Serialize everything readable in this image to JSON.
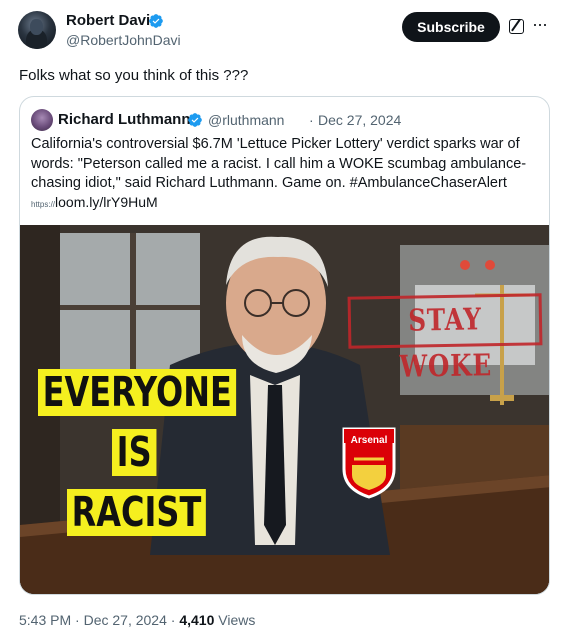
{
  "author": {
    "display_name": "Robert Davi",
    "handle": "@RobertJohnDavi",
    "verified_icon": "verified-badge-icon"
  },
  "actions": {
    "subscribe_label": "Subscribe",
    "grok_icon": "grok-icon",
    "more_icon": "more-options-icon",
    "more_glyph": "···"
  },
  "post": {
    "text": "Folks what so you think of this ???"
  },
  "quoted": {
    "display_name": "Richard Luthmann",
    "handle": "@rluthmann",
    "separator": "·",
    "date": "Dec 27, 2024",
    "body": "California's controversial $6.7M 'Lettuce Picker Lottery' verdict sparks war of words: \"Peterson called me a racist. I call him a WOKE scumbag ambulance-chasing idiot,\" said Richard Luthmann. Game on. #AmbulanceChaserAlert",
    "link_protocol": "https://",
    "link_text": "loom.ly/lrY9HuM",
    "image": {
      "caption_lines": [
        "EVERYONE",
        "IS",
        "RACIST"
      ],
      "stamp_text": "STAY WOKE",
      "badge_text": "Arsenal"
    }
  },
  "meta": {
    "time": "5:43 PM",
    "separator": "·",
    "date": "Dec 27, 2024",
    "separator2": "·",
    "views_count": "4,410",
    "views_label": "Views"
  },
  "colors": {
    "accent": "#1d9bf0",
    "text": "#0f1419",
    "muted": "#536471",
    "caption_bg": "#f5ef1f",
    "stamp": "#c0262a"
  }
}
